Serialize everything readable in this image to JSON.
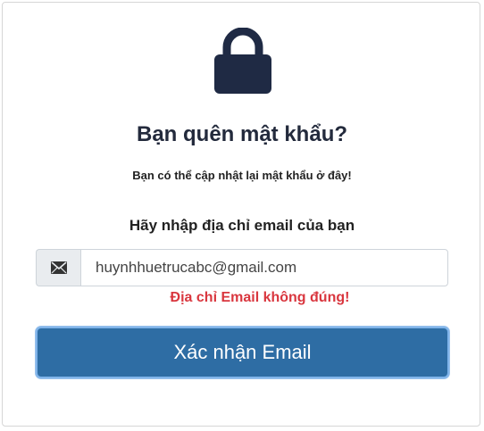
{
  "header": {
    "icon": "lock-icon",
    "icon_color": "#1f2a44",
    "title": "Bạn quên mật khẩu?",
    "subtitle": "Bạn có thể cập nhật lại mật khẩu ở đây!"
  },
  "form": {
    "prompt": "Hãy nhập địa chỉ email của bạn",
    "addon_icon": "envelope-icon",
    "email_value": "huynhhuetrucabc@gmail.com",
    "error_message": "Địa chỉ Email không đúng!",
    "submit_label": "Xác nhận Email"
  },
  "colors": {
    "accent": "#2e6da4",
    "error": "#d9363e"
  }
}
